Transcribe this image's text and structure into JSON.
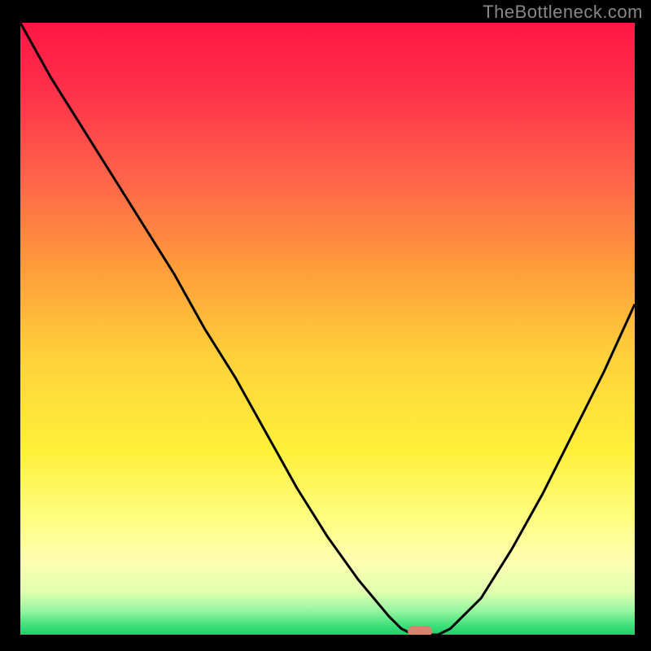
{
  "watermark": "TheBottleneck.com",
  "chart_data": {
    "type": "line",
    "title": "",
    "xlabel": "",
    "ylabel": "",
    "xlim": [
      0,
      100
    ],
    "ylim": [
      0,
      100
    ],
    "x": [
      0,
      5,
      10,
      15,
      20,
      25,
      30,
      35,
      40,
      45,
      50,
      55,
      60,
      62,
      64,
      66,
      68,
      70,
      75,
      80,
      85,
      90,
      95,
      100
    ],
    "y": [
      100,
      91,
      83,
      75,
      67,
      59,
      50,
      42,
      33,
      24,
      16,
      9,
      3,
      1,
      0,
      0,
      0,
      1,
      6,
      14,
      23,
      33,
      43,
      54
    ],
    "marker": {
      "x": 65,
      "y": 0
    },
    "gradient_stops": [
      {
        "offset": 0.0,
        "color": "#ff1744"
      },
      {
        "offset": 0.1,
        "color": "#ff2d4a"
      },
      {
        "offset": 0.25,
        "color": "#ff624a"
      },
      {
        "offset": 0.4,
        "color": "#ff9c3a"
      },
      {
        "offset": 0.55,
        "color": "#ffd23a"
      },
      {
        "offset": 0.7,
        "color": "#fff03a"
      },
      {
        "offset": 0.8,
        "color": "#fffc7a"
      },
      {
        "offset": 0.88,
        "color": "#ffffb0"
      },
      {
        "offset": 0.93,
        "color": "#e0ffb0"
      },
      {
        "offset": 0.96,
        "color": "#98f5a0"
      },
      {
        "offset": 0.985,
        "color": "#3fe07a"
      },
      {
        "offset": 1.0,
        "color": "#1ecf65"
      }
    ]
  }
}
